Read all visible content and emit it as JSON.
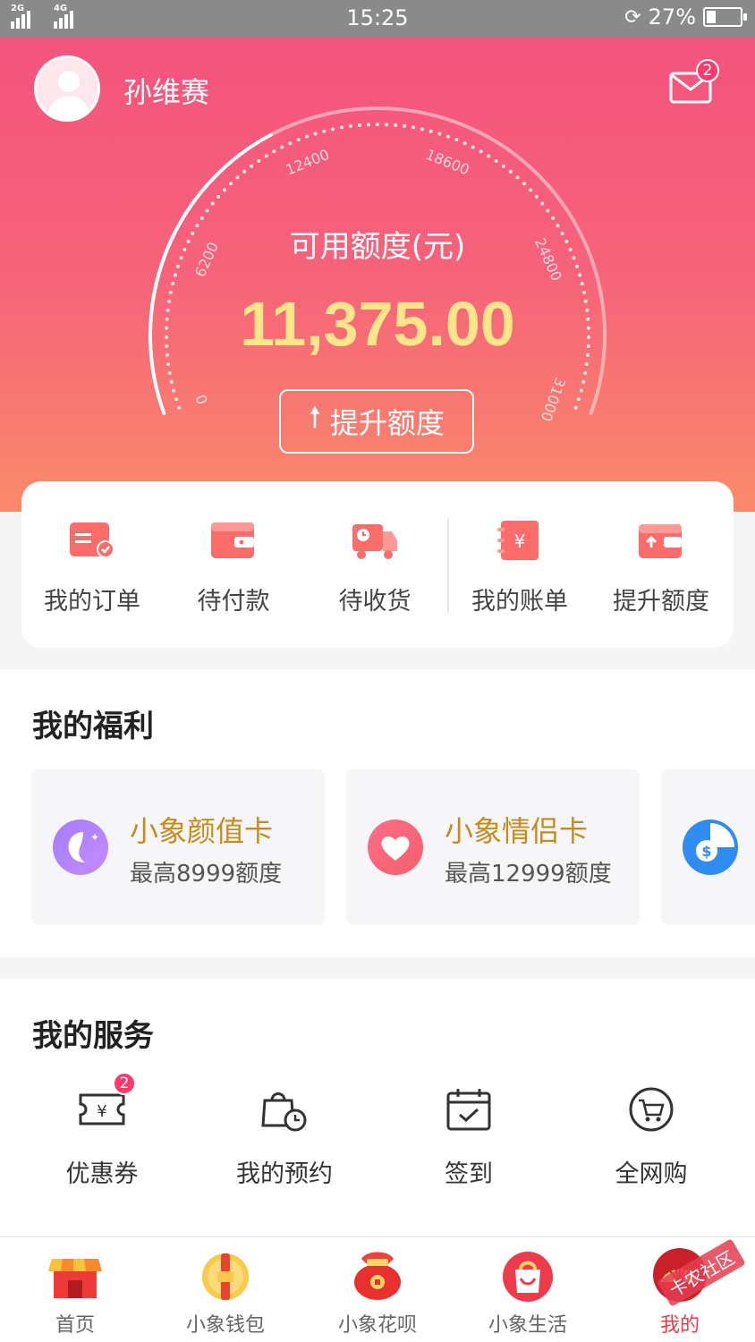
{
  "status_bar": {
    "sig1": "2G",
    "sig2": "4G",
    "time": "15:25",
    "battery": "27%",
    "battery_level": 0.27
  },
  "header": {
    "username": "孙维赛",
    "mail_badge": "2"
  },
  "gauge": {
    "label": "可用额度(元)",
    "value": "11,375.00",
    "ticks": [
      "0",
      "6200",
      "12400",
      "18600",
      "24800",
      "31000"
    ],
    "raise_button": "提升额度"
  },
  "quick_actions": [
    {
      "label": "我的订单",
      "icon": "order-icon"
    },
    {
      "label": "待付款",
      "icon": "wallet-icon"
    },
    {
      "label": "待收货",
      "icon": "truck-icon"
    },
    {
      "label": "我的账单",
      "icon": "bill-icon"
    },
    {
      "label": "提升额度",
      "icon": "raise-limit-icon"
    }
  ],
  "benefits": {
    "title": "我的福利",
    "cards": [
      {
        "name": "小象颜值卡",
        "desc": "最高8999额度",
        "icon": "face-icon"
      },
      {
        "name": "小象情侣卡",
        "desc": "最高12999额度",
        "icon": "heart-icon"
      }
    ]
  },
  "services": {
    "title": "我的服务",
    "items": [
      {
        "label": "优惠券",
        "icon": "coupon-icon",
        "badge": "2"
      },
      {
        "label": "我的预约",
        "icon": "appointment-icon"
      },
      {
        "label": "签到",
        "icon": "calendar-check-icon"
      },
      {
        "label": "全网购",
        "icon": "cart-icon"
      }
    ]
  },
  "bottom_nav": [
    {
      "label": "首页",
      "icon": "shop-icon"
    },
    {
      "label": "小象钱包",
      "icon": "coin-icon"
    },
    {
      "label": "小象花呗",
      "icon": "red-bag-icon"
    },
    {
      "label": "小象生活",
      "icon": "shopping-bag-icon"
    },
    {
      "label": "我的",
      "icon": "profile-fan-icon",
      "active": true
    }
  ],
  "watermark": "卡农社区",
  "colors": {
    "primary": "#f4547e",
    "gold": "#c58b1e",
    "amount": "#ffe58a",
    "active": "#ef3a4b"
  }
}
